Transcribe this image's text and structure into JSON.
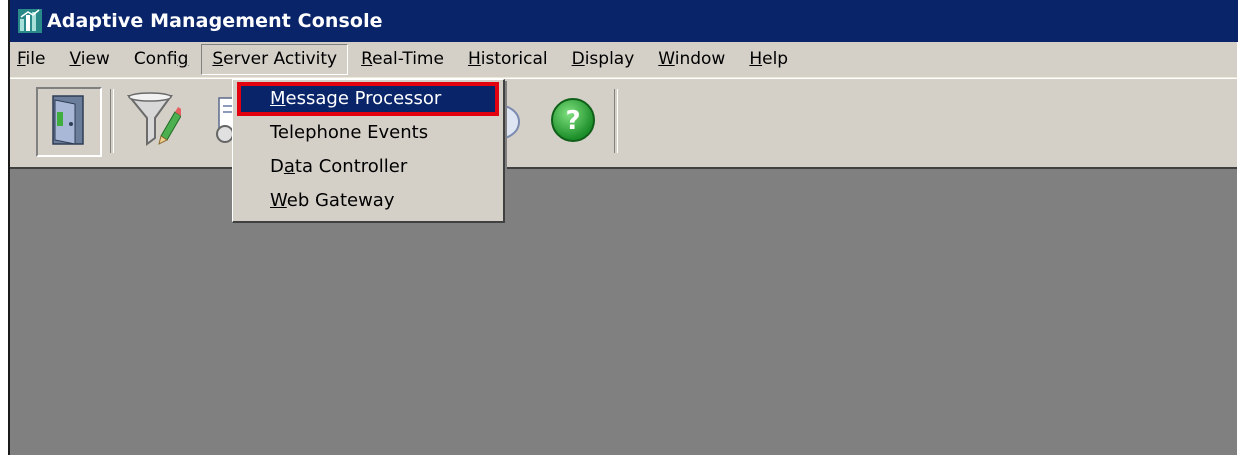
{
  "window": {
    "title": "Adaptive Management Console"
  },
  "menubar": {
    "items": [
      {
        "pre": "",
        "ul": "F",
        "post": "ile"
      },
      {
        "pre": "",
        "ul": "V",
        "post": "iew"
      },
      {
        "pre": "Confi",
        "ul": "g",
        "post": ""
      },
      {
        "pre": "",
        "ul": "S",
        "post": "erver Activity"
      },
      {
        "pre": "",
        "ul": "R",
        "post": "eal-Time"
      },
      {
        "pre": "",
        "ul": "H",
        "post": "istorical"
      },
      {
        "pre": "",
        "ul": "D",
        "post": "isplay"
      },
      {
        "pre": "",
        "ul": "W",
        "post": "indow"
      },
      {
        "pre": "",
        "ul": "H",
        "post": "elp"
      }
    ],
    "open_menu": "Server Activity"
  },
  "dropdown": {
    "items": [
      {
        "pre": "",
        "ul": "M",
        "post": "essage Processor",
        "selected": true
      },
      {
        "pre": "Telephone Events",
        "ul": "",
        "post": "",
        "selected": false
      },
      {
        "pre": "D",
        "ul": "a",
        "post": "ta Controller",
        "selected": false
      },
      {
        "pre": "",
        "ul": "W",
        "post": "eb Gateway",
        "selected": false
      }
    ]
  },
  "toolbar": {
    "buttons": [
      {
        "icon": "door-icon"
      },
      {
        "icon": "filter-edit-icon"
      },
      {
        "icon": "report-icon"
      },
      {
        "icon": "chat-icon"
      },
      {
        "icon": "help-icon"
      }
    ]
  },
  "colors": {
    "titlebar": "#0a246a",
    "chrome": "#d4d0c8",
    "workspace": "#808080",
    "highlight_border": "#e3000f"
  }
}
